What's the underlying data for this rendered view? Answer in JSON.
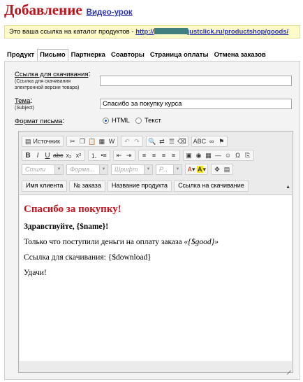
{
  "header": {
    "title": "Добавление",
    "video_link": "Видео-урок"
  },
  "notice": {
    "text": "Это ваша ссылка на каталог продуктов - ",
    "url_prefix": "http://",
    "url_suffix": "justclick.ru/productshop/goods/"
  },
  "tabs": [
    {
      "label": "Продукт"
    },
    {
      "label": "Письмо",
      "active": true
    },
    {
      "label": "Партнерка"
    },
    {
      "label": "Соавторы"
    },
    {
      "label": "Страница оплаты"
    },
    {
      "label": "Отмена заказов"
    }
  ],
  "form": {
    "download_link": {
      "label": "Ссылка для скачивания",
      "sublabel_1": "(Ссылка для скачивания",
      "sublabel_2": "электронной версии товара)",
      "value": ""
    },
    "subject": {
      "label": "Тема",
      "sublabel": "(Subject)",
      "value": "Спасибо за покупку курса"
    },
    "format": {
      "label": "Формат письма",
      "options": [
        "HTML",
        "Текст"
      ],
      "selected": "HTML"
    }
  },
  "editor": {
    "source_label": "Источник",
    "combos": {
      "styles": "Стили",
      "format": "Форма...",
      "font": "Шрифт",
      "size": "Р..."
    },
    "templates": [
      "Имя клиента",
      "№ заказа",
      "Название продукта",
      "Ссылка на скачивание"
    ],
    "content": {
      "heading": "Спасибо за покупку!",
      "greeting": "Здравствуйте, {$name}!",
      "line1": "Только что поступили деньги на оплату заказа ",
      "line1_var": "«{$good}»",
      "line2": "Ссылка для скачивания: {$download}",
      "line3": "Удачи!"
    }
  },
  "colors": {
    "title": "#b8141b",
    "link": "#2a36b0",
    "notice_bg": "#fffbc8",
    "heading": "#c3131c"
  }
}
